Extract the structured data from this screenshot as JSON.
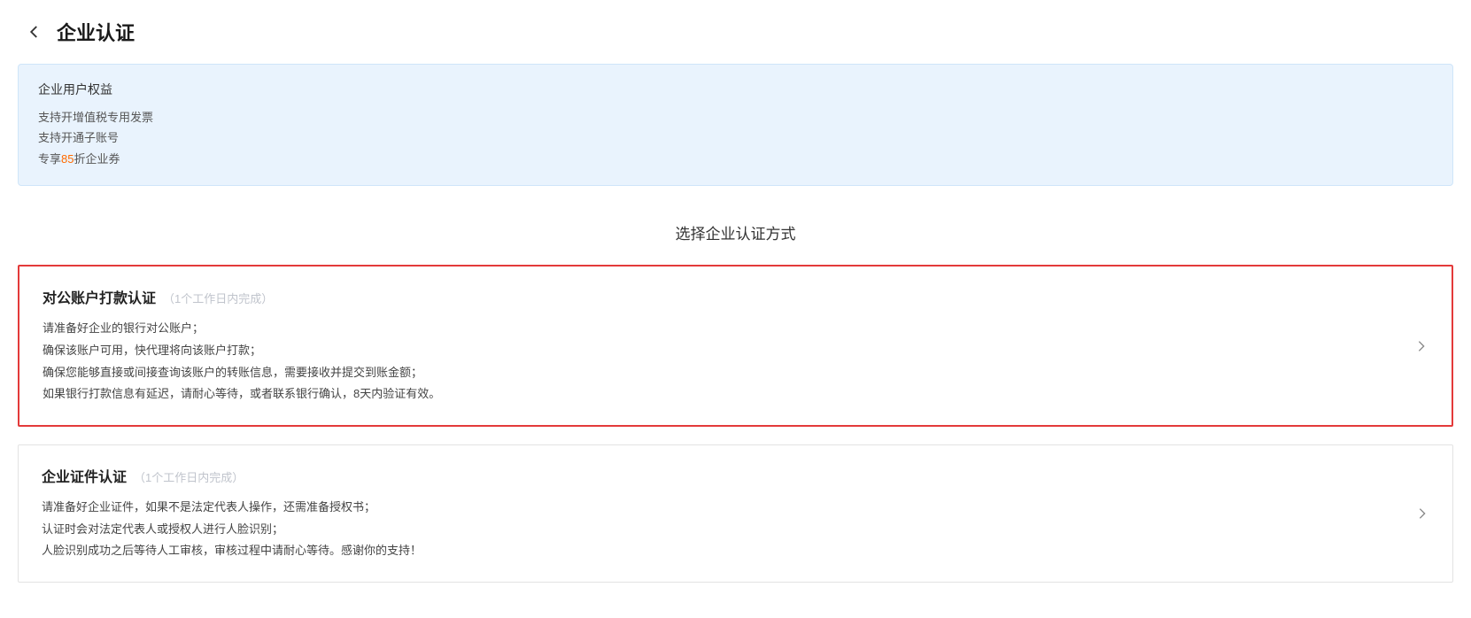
{
  "header": {
    "title": "企业认证"
  },
  "benefits": {
    "title": "企业用户权益",
    "items": [
      {
        "prefix": "",
        "highlight": "",
        "text": "支持开增值税专用发票"
      },
      {
        "prefix": "",
        "highlight": "",
        "text": "支持开通子账号"
      },
      {
        "prefix": "专享",
        "highlight": "85",
        "text": "折企业券"
      }
    ]
  },
  "section_title": "选择企业认证方式",
  "options": [
    {
      "title": "对公账户打款认证",
      "note": "（1个工作日内完成）",
      "highlighted": true,
      "desc": [
        "请准备好企业的银行对公账户；",
        "确保该账户可用，快代理将向该账户打款；",
        "确保您能够直接或间接查询该账户的转账信息，需要接收并提交到账金额；",
        "如果银行打款信息有延迟，请耐心等待，或者联系银行确认，8天内验证有效。"
      ]
    },
    {
      "title": "企业证件认证",
      "note": "（1个工作日内完成）",
      "highlighted": false,
      "desc": [
        "请准备好企业证件，如果不是法定代表人操作，还需准备授权书；",
        "认证时会对法定代表人或授权人进行人脸识别；",
        "人脸识别成功之后等待人工审核，审核过程中请耐心等待。感谢你的支持！"
      ]
    }
  ]
}
